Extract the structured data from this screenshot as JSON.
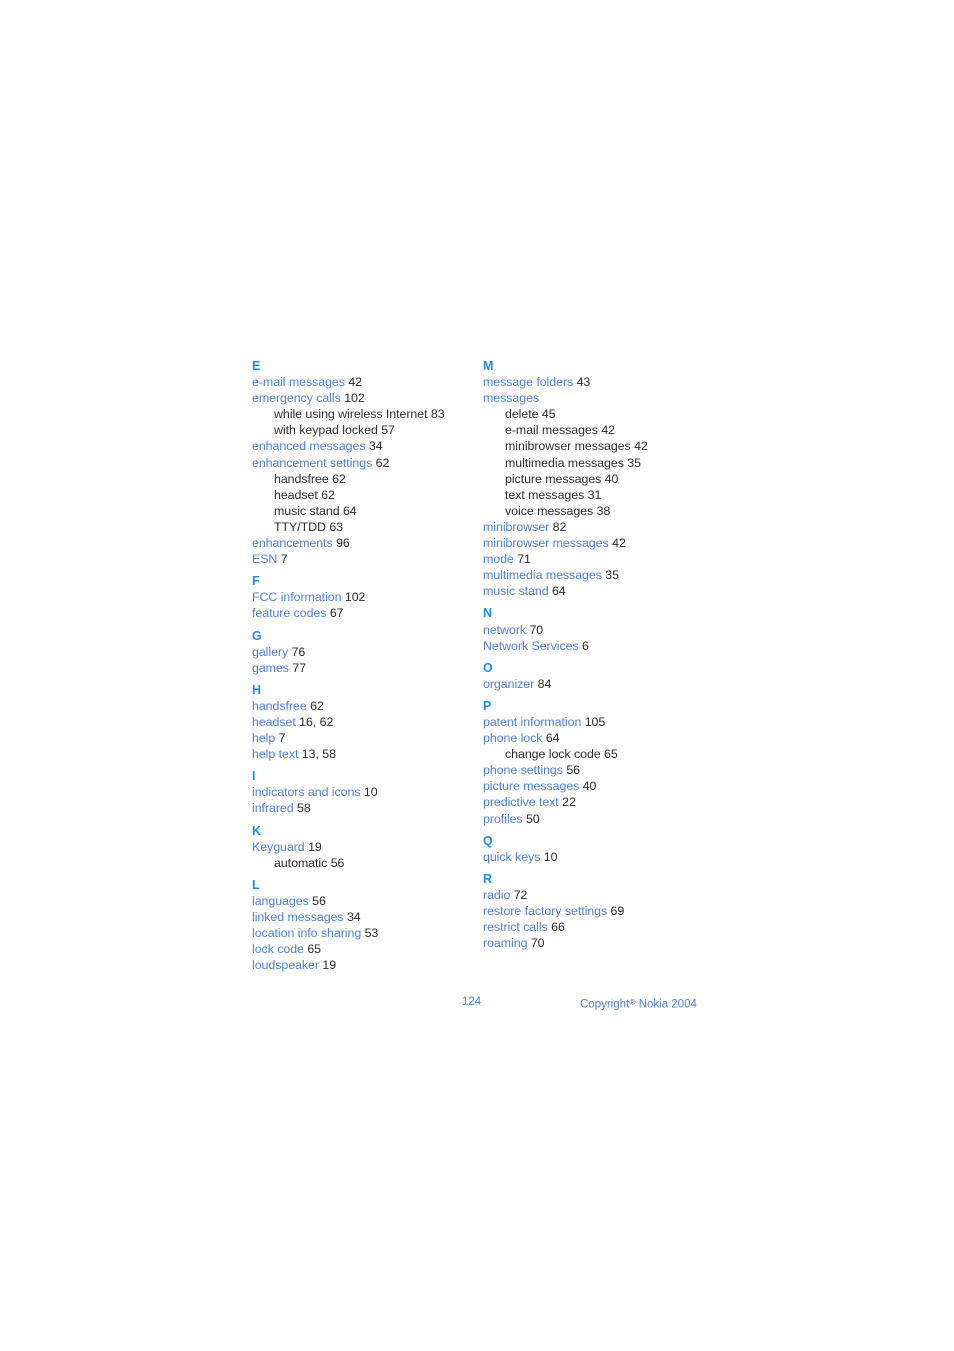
{
  "document": {
    "page_number": "124",
    "copyright_prefix": "Copyright",
    "copyright_mark": "®",
    "copyright_suffix": "Nokia 2004",
    "accent_heading_color": "#1f8cf0",
    "entry_term_color": "#4e7fd8",
    "page_number_color": "#2c2c2c"
  },
  "index": {
    "columns": [
      {
        "sections": [
          {
            "letter": "E",
            "entries": [
              {
                "term": "e-mail messages",
                "pages": "42",
                "level": 0
              },
              {
                "term": "emergency calls",
                "pages": "102",
                "level": 0
              },
              {
                "term": "while using wireless Internet",
                "pages": "83",
                "level": 1
              },
              {
                "term": "with keypad locked",
                "pages": "57",
                "level": 1
              },
              {
                "term": "enhanced messages",
                "pages": "34",
                "level": 0
              },
              {
                "term": "enhancement settings",
                "pages": "62",
                "level": 0
              },
              {
                "term": "handsfree",
                "pages": "62",
                "level": 1
              },
              {
                "term": "headset",
                "pages": "62",
                "level": 1
              },
              {
                "term": "music stand",
                "pages": "64",
                "level": 1
              },
              {
                "term": "TTY/TDD",
                "pages": "63",
                "level": 1
              },
              {
                "term": "enhancements",
                "pages": "96",
                "level": 0
              },
              {
                "term": "ESN",
                "pages": "7",
                "level": 0
              }
            ]
          },
          {
            "letter": "F",
            "entries": [
              {
                "term": "FCC information",
                "pages": "102",
                "level": 0
              },
              {
                "term": "feature codes",
                "pages": "67",
                "level": 0
              }
            ]
          },
          {
            "letter": "G",
            "entries": [
              {
                "term": "gallery",
                "pages": "76",
                "level": 0
              },
              {
                "term": "games",
                "pages": "77",
                "level": 0
              }
            ]
          },
          {
            "letter": "H",
            "entries": [
              {
                "term": "handsfree",
                "pages": "62",
                "level": 0
              },
              {
                "term": "headset",
                "pages": "16, 62",
                "level": 0
              },
              {
                "term": "help",
                "pages": "7",
                "level": 0
              },
              {
                "term": "help text",
                "pages": "13, 58",
                "level": 0
              }
            ]
          },
          {
            "letter": "I",
            "entries": [
              {
                "term": "indicators and icons",
                "pages": "10",
                "level": 0
              },
              {
                "term": "infrared",
                "pages": "58",
                "level": 0
              }
            ]
          },
          {
            "letter": "K",
            "entries": [
              {
                "term": "Keyguard",
                "pages": "19",
                "level": 0
              },
              {
                "term": "automatic",
                "pages": "56",
                "level": 1
              }
            ]
          },
          {
            "letter": "L",
            "entries": [
              {
                "term": "languages",
                "pages": "56",
                "level": 0
              },
              {
                "term": "linked messages",
                "pages": "34",
                "level": 0
              },
              {
                "term": "location info sharing",
                "pages": "53",
                "level": 0
              },
              {
                "term": "lock code",
                "pages": "65",
                "level": 0
              },
              {
                "term": "loudspeaker",
                "pages": "19",
                "level": 0
              }
            ]
          }
        ]
      },
      {
        "sections": [
          {
            "letter": "M",
            "entries": [
              {
                "term": "message folders",
                "pages": "43",
                "level": 0
              },
              {
                "term": "messages",
                "pages": "",
                "level": 0
              },
              {
                "term": "delete",
                "pages": "45",
                "level": 1
              },
              {
                "term": "e-mail messages",
                "pages": "42",
                "level": 1
              },
              {
                "term": "minibrowser messages",
                "pages": "42",
                "level": 1
              },
              {
                "term": "multimedia messages",
                "pages": "35",
                "level": 1
              },
              {
                "term": "picture messages",
                "pages": "40",
                "level": 1
              },
              {
                "term": "text messages",
                "pages": "31",
                "level": 1
              },
              {
                "term": "voice messages",
                "pages": "38",
                "level": 1
              },
              {
                "term": "minibrowser",
                "pages": "82",
                "level": 0
              },
              {
                "term": "minibrowser messages",
                "pages": "42",
                "level": 0
              },
              {
                "term": "mode",
                "pages": "71",
                "level": 0
              },
              {
                "term": "multimedia messages",
                "pages": "35",
                "level": 0
              },
              {
                "term": "music stand",
                "pages": "64",
                "level": 0
              }
            ]
          },
          {
            "letter": "N",
            "entries": [
              {
                "term": "network",
                "pages": "70",
                "level": 0
              },
              {
                "term": "Network Services",
                "pages": "6",
                "level": 0
              }
            ]
          },
          {
            "letter": "O",
            "entries": [
              {
                "term": "organizer",
                "pages": "84",
                "level": 0
              }
            ]
          },
          {
            "letter": "P",
            "entries": [
              {
                "term": "patent information",
                "pages": "105",
                "level": 0
              },
              {
                "term": "phone lock",
                "pages": "64",
                "level": 0
              },
              {
                "term": "change lock code",
                "pages": "65",
                "level": 1
              },
              {
                "term": "phone settings",
                "pages": "56",
                "level": 0
              },
              {
                "term": "picture messages",
                "pages": "40",
                "level": 0
              },
              {
                "term": "predictive text",
                "pages": "22",
                "level": 0
              },
              {
                "term": "profiles",
                "pages": "50",
                "level": 0
              }
            ]
          },
          {
            "letter": "Q",
            "entries": [
              {
                "term": "quick keys",
                "pages": "10",
                "level": 0
              }
            ]
          },
          {
            "letter": "R",
            "entries": [
              {
                "term": "radio",
                "pages": "72",
                "level": 0
              },
              {
                "term": "restore factory settings",
                "pages": "69",
                "level": 0
              },
              {
                "term": "restrict calls",
                "pages": "66",
                "level": 0
              },
              {
                "term": "roaming",
                "pages": "70",
                "level": 0
              }
            ]
          }
        ]
      }
    ]
  }
}
